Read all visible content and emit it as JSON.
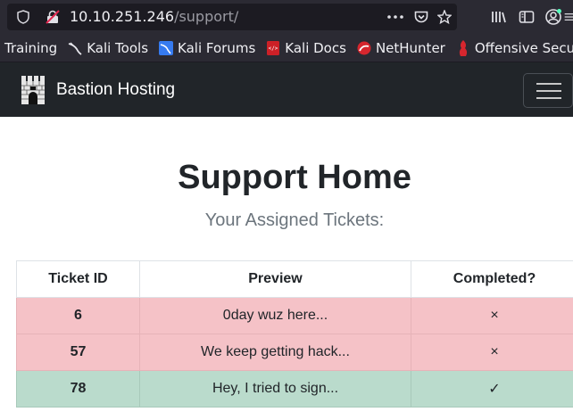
{
  "browser": {
    "url_host": "10.10.251.246",
    "url_path": "/support/",
    "icons": [
      "shield-icon",
      "insecure-lock-icon",
      "more-icon",
      "pocket-icon",
      "bookmark-star-icon",
      "library-icon",
      "sidebar-icon",
      "account-icon",
      "menu-icon"
    ]
  },
  "bookmarks": [
    {
      "label": "Training",
      "icon": "none"
    },
    {
      "label": "Kali Tools",
      "icon": "kali-dragon-icon"
    },
    {
      "label": "Kali Forums",
      "icon": "kali-forums-icon"
    },
    {
      "label": "Kali Docs",
      "icon": "kali-docs-icon"
    },
    {
      "label": "NetHunter",
      "icon": "nethunter-icon"
    },
    {
      "label": "Offensive Security",
      "icon": "offsec-icon"
    }
  ],
  "navbar": {
    "brand": "Bastion Hosting",
    "logo_icon": "castle-icon",
    "toggler_icon": "hamburger-icon"
  },
  "page": {
    "title": "Support Home",
    "subtitle": "Your Assigned Tickets:"
  },
  "table": {
    "headers": [
      "Ticket ID",
      "Preview",
      "Completed?"
    ],
    "rows": [
      {
        "id": "6",
        "preview": "0day wuz here...",
        "completed": "×",
        "status": "danger"
      },
      {
        "id": "57",
        "preview": "We keep getting hack...",
        "completed": "×",
        "status": "danger"
      },
      {
        "id": "78",
        "preview": "Hey, I tried to sign...",
        "completed": "✓",
        "status": "success"
      }
    ]
  },
  "colors": {
    "browser_chrome": "#2b2a33",
    "navbar": "#212529",
    "row_danger": "#f5c2c7",
    "row_success": "#badbcc"
  }
}
